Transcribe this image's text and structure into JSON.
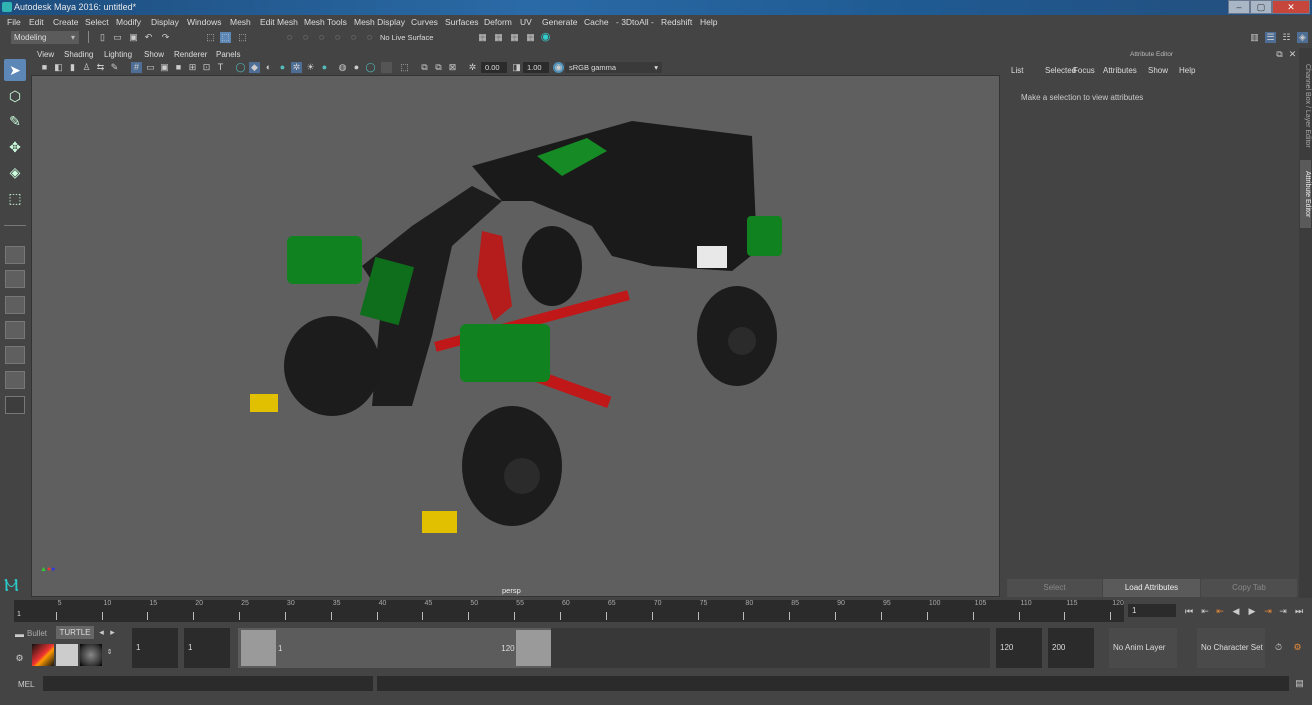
{
  "window": {
    "title": "Autodesk Maya 2016: untitled*",
    "controls": [
      "minimize",
      "maximize",
      "close"
    ]
  },
  "menubar": [
    "File",
    "Edit",
    "Create",
    "Select",
    "Modify",
    "Display",
    "Windows",
    "Mesh",
    "Edit Mesh",
    "Mesh Tools",
    "Mesh Display",
    "Curves",
    "Surfaces",
    "Deform",
    "UV",
    "Generate",
    "Cache",
    "- 3DtoAll -",
    "Redshift",
    "Help"
  ],
  "toolbar": {
    "mode": "Modeling",
    "live_surface": "No Live Surface"
  },
  "viewport_menu": [
    "View",
    "Shading",
    "Lighting",
    "Show",
    "Renderer",
    "Panels"
  ],
  "viewport_toolbar": {
    "exposure": "0.00",
    "gamma": "1.00",
    "color_space": "sRGB gamma"
  },
  "viewport": {
    "camera": "persp"
  },
  "attribute_editor": {
    "title": "Attribute Editor",
    "menu": [
      "List",
      "Selected",
      "Focus",
      "Attributes",
      "Show",
      "Help"
    ],
    "message": "Make a selection to view attributes",
    "buttons": {
      "select": "Select",
      "load": "Load Attributes",
      "copy": "Copy Tab"
    }
  },
  "side_tabs": [
    "Channel Box / Layer Editor",
    "Attribute Editor"
  ],
  "timeline": {
    "ticks": [
      5,
      10,
      15,
      20,
      25,
      30,
      35,
      40,
      45,
      50,
      55,
      60,
      65,
      70,
      75,
      80,
      85,
      90,
      95,
      100,
      105,
      110,
      115,
      120
    ],
    "start_label": "1",
    "current_frame": "1"
  },
  "range": {
    "start": "1",
    "end_start": "1",
    "range_start": "1",
    "range_end": "120",
    "anim_end": "120",
    "max_end": "200",
    "anim_layer": "No Anim Layer",
    "character_set": "No Character Set"
  },
  "shelf": {
    "tabs": [
      "Bullet",
      "TURTLE"
    ]
  },
  "mel": {
    "label": "MEL"
  }
}
